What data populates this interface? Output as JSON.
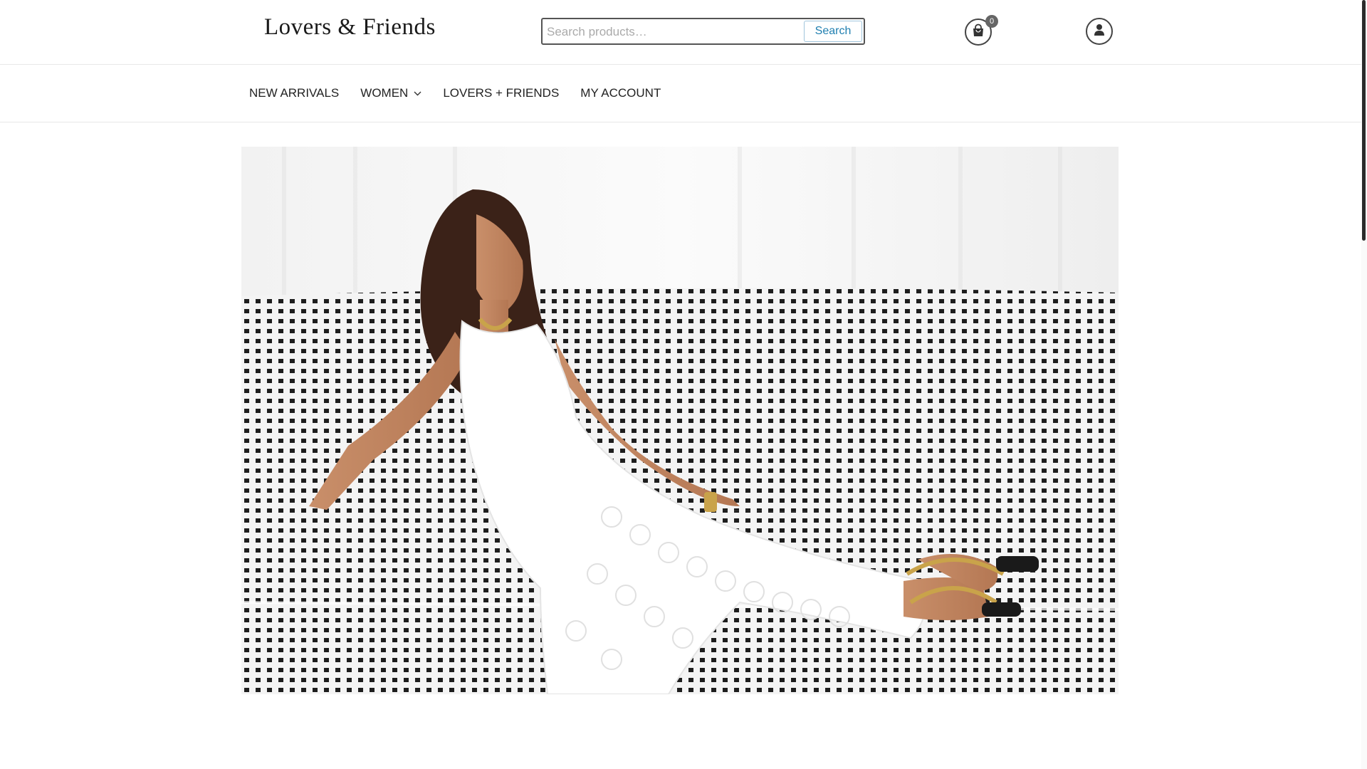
{
  "header": {
    "logo_text": "Lovers & Friends",
    "search": {
      "placeholder": "Search products…",
      "button_label": "Search"
    },
    "cart": {
      "icon": "shopping-bag-icon",
      "count": "0"
    },
    "account": {
      "icon": "user-icon"
    }
  },
  "nav": {
    "items": [
      {
        "label": "NEW ARRIVALS"
      },
      {
        "label": "WOMEN",
        "has_dropdown": true
      },
      {
        "label": "LOVERS + FRIENDS"
      },
      {
        "label": "MY ACCOUNT"
      }
    ]
  },
  "hero": {
    "image": "fashion-model-white-crochet-dress-on-checkered-sofa"
  },
  "colors": {
    "accent": "#1f7fb0",
    "border": "#555555",
    "badge": "#666666"
  }
}
